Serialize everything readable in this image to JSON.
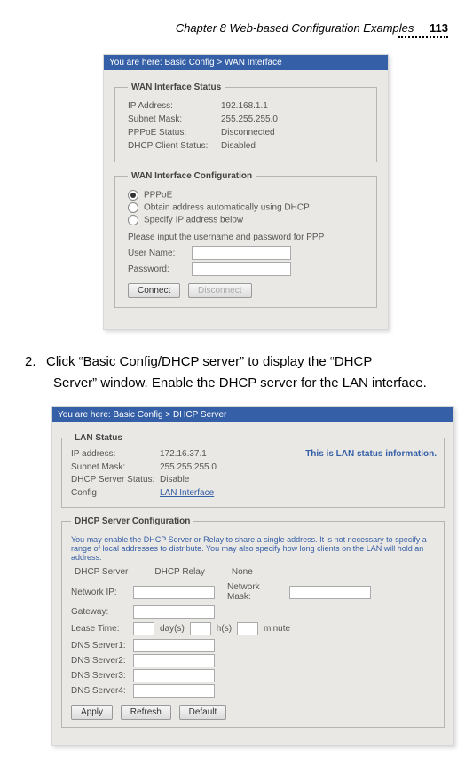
{
  "header": {
    "chapter": "Chapter 8 Web-based Configuration Examples",
    "page_number": "113"
  },
  "screenshot1": {
    "breadcrumb": "You are here: Basic Config > WAN Interface",
    "status": {
      "legend": "WAN Interface Status",
      "ip_label": "IP Address:",
      "ip_value": "192.168.1.1",
      "mask_label": "Subnet Mask:",
      "mask_value": "255.255.255.0",
      "pppoe_label": "PPPoE Status:",
      "pppoe_value": "Disconnected",
      "dhcp_label": "DHCP Client Status:",
      "dhcp_value": "Disabled"
    },
    "config": {
      "legend": "WAN Interface Configuration",
      "opt_pppoe": "PPPoE",
      "opt_dhcp": "Obtain address automatically using DHCP",
      "opt_spec": "Specify IP address below",
      "instruction": "Please input the username and password for PPP",
      "user_label": "User Name:",
      "pass_label": "Password:",
      "btn_connect": "Connect",
      "btn_disconnect": "Disconnect"
    }
  },
  "body": {
    "step_num": "2.",
    "step_text": "Click “Basic Config/DHCP server” to display the “DHCP Server” window. Enable the DHCP server for the LAN interface."
  },
  "screenshot2": {
    "breadcrumb": "You are here: Basic Config > DHCP Server",
    "lan": {
      "legend": "LAN Status",
      "ip_label": "IP address:",
      "ip_value": "172.16.37.1",
      "mask_label": "Subnet Mask:",
      "mask_value": "255.255.255.0",
      "dhcp_label": "DHCP Server Status:",
      "dhcp_value": "Disable",
      "link_label": "Config",
      "link_text": "LAN Interface",
      "note": "This is LAN status information."
    },
    "dhcp": {
      "legend": "DHCP Server Configuration",
      "help": "You may enable the DHCP Server or Relay to share a single address. It is not necessary to specify a range of local addresses to distribute. You may also specify how long clients on the LAN will hold an address.",
      "opt_server": "DHCP Server",
      "opt_relay": "DHCP Relay",
      "opt_none": "None",
      "net_ip": "Network IP:",
      "net_mask": "Network Mask:",
      "gateway": "Gateway:",
      "lease": "Lease Time:",
      "lease_units": {
        "d": "day(s)",
        "h": "h(s)",
        "m": "minute"
      },
      "dns1": "DNS Server1:",
      "dns2": "DNS Server2:",
      "dns3": "DNS Server3:",
      "dns4": "DNS Server4:",
      "btn_apply": "Apply",
      "btn_refresh": "Refresh",
      "btn_default": "Default"
    }
  }
}
